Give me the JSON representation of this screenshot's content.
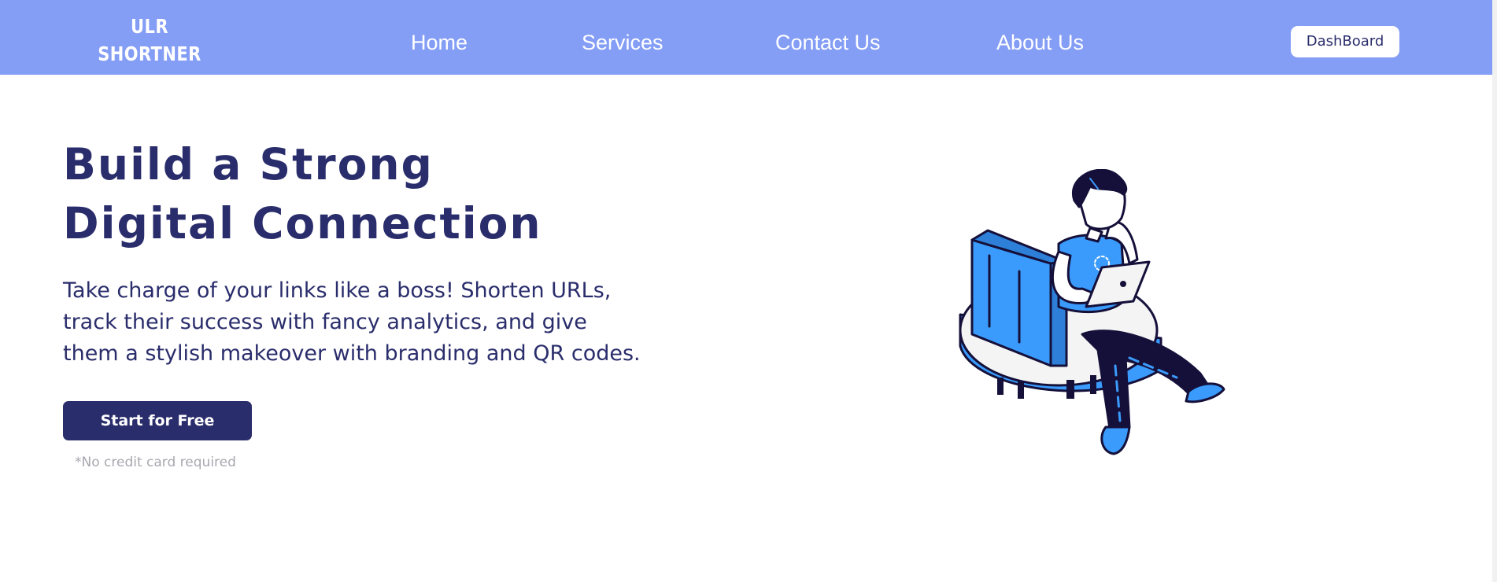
{
  "nav": {
    "logo_line1": "ULR",
    "logo_line2": "SHORTNER",
    "links": [
      "Home",
      "Services",
      "Contact Us",
      "About Us"
    ],
    "dashboard_label": "DashBoard"
  },
  "hero": {
    "title_line1": "Build a Strong",
    "title_line2": "Digital Connection",
    "text_lines": [
      "Take charge of your links like a boss! Shorten URLs,",
      "track their success with fancy analytics, and give",
      "them a stylish makeover with branding and QR codes."
    ],
    "cta_label": "Start for Free",
    "note": "*No credit card required"
  },
  "colors": {
    "navbar": "#849df5",
    "primary_navy": "#2a2d6b",
    "accent_blue": "#3a9bfc",
    "muted_text": "#a8a8b0"
  },
  "icons": {
    "illustration": "person-with-laptop-on-pie-chart"
  }
}
